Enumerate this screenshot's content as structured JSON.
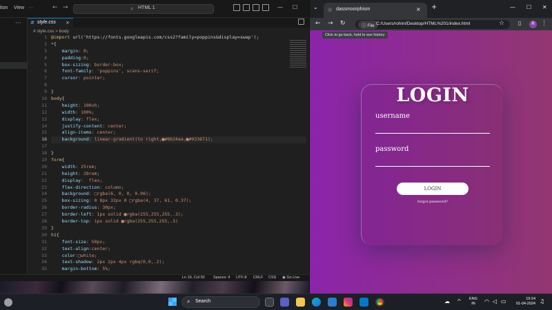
{
  "vscode": {
    "menu": [
      "tion",
      "View"
    ],
    "search": "HTML 1",
    "tab": {
      "name": "style.css",
      "icon": "#"
    },
    "breadcrumb": {
      "file": "style.css",
      "sep": ">",
      "symbol": "body"
    },
    "line_numbers": [
      "1",
      "2",
      "3",
      "4",
      "5",
      "6",
      "7",
      "8",
      "9",
      "10",
      "11",
      "12",
      "13",
      "14",
      "15",
      "16",
      "17",
      "18",
      "19",
      "20",
      "21",
      "22",
      "23",
      "24",
      "25",
      "26",
      "27",
      "28",
      "29",
      "30",
      "31",
      "32",
      "33",
      "34",
      "35"
    ],
    "current_line": 16,
    "code_lines": [
      "@import url('https://fonts.googleapis.com/css2?family=poppins&display=swap');",
      "*{",
      "    margin: 0;",
      "    padding:0;",
      "    box-sizing: border-box;",
      "    font-family: 'poppins', scans-serif;",
      "    cursor: pointer;",
      "",
      "}",
      "body{",
      "    height: 100vh;",
      "    width: 100%;",
      "    display: flex;",
      "    justify-content: center;",
      "    align-items: center;",
      "    background: linear-gradient(to right,■#8b24aa,■#933671);",
      "",
      "}",
      "form{",
      "    width: 25rem;",
      "    height: 28rem;",
      "    display:  flex;",
      "    flex-direction: column;",
      "    background: □rgba(6, 0, 0, 0.06);",
      "    box-sizing: 0 8px 32px 0 □rgba(4, 37, 61, 0.37);",
      "    border-radius: 30px;",
      "    border-left: 1px solid ■rgba(255,255,255,.3);",
      "    border-top: 1px solid ■rgba(255,255,255,.3)",
      "}",
      "h1{",
      "    font-size: 50px;",
      "    text-align:center;",
      "    color:□white;",
      "    text-shadow: 2px 2px 4px rgbq(0,0,.2);",
      "    margin-bottom: 5%;"
    ],
    "status": {
      "position": "Ln 16, Col 50",
      "spaces": "Spaces: 4",
      "encoding": "UTF-8",
      "eol": "CRLF",
      "language": "CSS",
      "golive": "Go Live"
    }
  },
  "browser": {
    "tab_title": "dassmoorphism",
    "url_chip": "File",
    "url": "C:/Users/rohini/Desktop/HTML%201/index.html",
    "avatar_letter": "R",
    "tooltip": "Click to go back, hold to see history",
    "page": {
      "title": "LOGIN",
      "username_label": "username",
      "password_label": "password",
      "login_button": "LOGIN",
      "forgot_link": "forgot password?"
    },
    "gradient": {
      "from": "#8b24aa",
      "to": "#933671"
    }
  },
  "taskbar": {
    "search": "Search",
    "lang_line1": "ENG",
    "lang_line2": "IN",
    "time": "19:24",
    "date": "01-04-2024"
  }
}
